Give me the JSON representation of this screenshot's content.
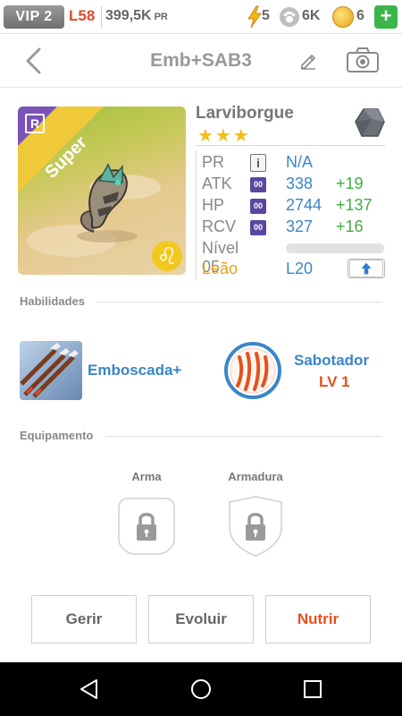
{
  "status": {
    "vip": "VIP 2",
    "level": "L58",
    "power": "399,5K",
    "power_unit": "PR",
    "energy": "5",
    "paw_count": "6K",
    "coins": "6",
    "add": "+"
  },
  "header": {
    "title": "Emb+SAB3"
  },
  "pet": {
    "rarity_badge": "R",
    "grade": "Super",
    "zodiac_symbol": "♌",
    "name": "Larviborgue",
    "stars": "★★★",
    "stats": {
      "pr": {
        "label": "PR",
        "info": "i",
        "value": "N/A"
      },
      "atk": {
        "label": "ATK",
        "badge": "00",
        "value": "338",
        "bonus": "+19"
      },
      "hp": {
        "label": "HP",
        "badge": "00",
        "value": "2744",
        "bonus": "+137"
      },
      "rcv": {
        "label": "RCV",
        "badge": "00",
        "value": "327",
        "bonus": "+16"
      }
    },
    "level_label": "Nível 05",
    "level_progress": 0,
    "sign": "Leão",
    "level_cap": "L20"
  },
  "abilities": {
    "section_title": "Habilidades",
    "items": [
      {
        "name": "Emboscada+",
        "icon": "arrows-icon"
      },
      {
        "name": "Sabotador",
        "level": "LV 1",
        "icon": "claw-marks-icon"
      }
    ]
  },
  "equipment": {
    "section_title": "Equipamento",
    "slots": [
      {
        "label": "Arma",
        "state": "locked"
      },
      {
        "label": "Armadura",
        "state": "locked"
      }
    ]
  },
  "actions": {
    "manage": "Gerir",
    "evolve": "Evoluir",
    "feed": "Nutrir"
  },
  "colors": {
    "accent_blue": "#3a86c8",
    "bonus_green": "#3fae3f",
    "accent_orange": "#e3521f",
    "gold": "#f2bd16"
  }
}
